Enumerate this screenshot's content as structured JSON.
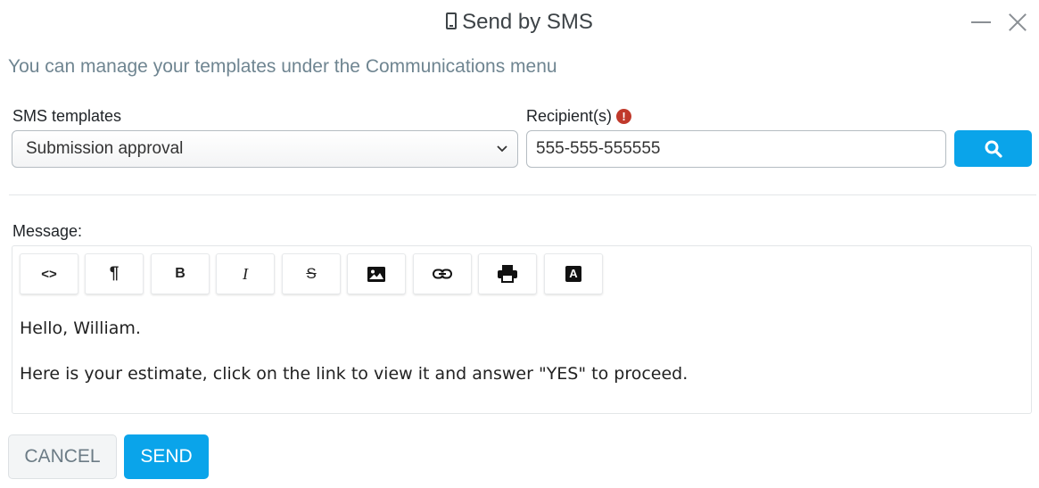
{
  "window": {
    "title": "Send by SMS",
    "title_icon": "mobile-phone-icon",
    "minimize_icon": "minimize-icon",
    "close_icon": "close-icon"
  },
  "subtitle": "You can manage your templates under the Communications menu",
  "templates": {
    "label": "SMS templates",
    "selected": "Submission approval"
  },
  "recipients": {
    "label": "Recipient(s)",
    "warning_icon": "exclamation-circle-icon",
    "warning_color": "#c0392b",
    "value": "555-555-555555",
    "search_icon": "search-icon"
  },
  "message": {
    "label": "Message:",
    "toolbar": [
      {
        "name": "code-view-button",
        "icon": "code-icon",
        "glyph": "<>"
      },
      {
        "name": "paragraph-button",
        "icon": "paragraph-icon",
        "glyph": "¶"
      },
      {
        "name": "bold-button",
        "icon": "bold-icon",
        "glyph": "B"
      },
      {
        "name": "italic-button",
        "icon": "italic-icon",
        "glyph": "I"
      },
      {
        "name": "strikethrough-button",
        "icon": "strikethrough-icon",
        "glyph": "S"
      },
      {
        "name": "image-button",
        "icon": "image-icon",
        "glyph": ""
      },
      {
        "name": "link-button",
        "icon": "link-icon",
        "glyph": ""
      },
      {
        "name": "print-button",
        "icon": "print-icon",
        "glyph": ""
      },
      {
        "name": "font-button",
        "icon": "font-icon",
        "glyph": "A"
      }
    ],
    "lines": [
      "Hello, William.",
      "Here is your estimate, click on the link to view it and answer \"YES\" to proceed."
    ]
  },
  "actions": {
    "cancel_label": "CANCEL",
    "send_label": "SEND"
  },
  "colors": {
    "accent": "#0aa4ea",
    "subtitle": "#6f8591"
  }
}
